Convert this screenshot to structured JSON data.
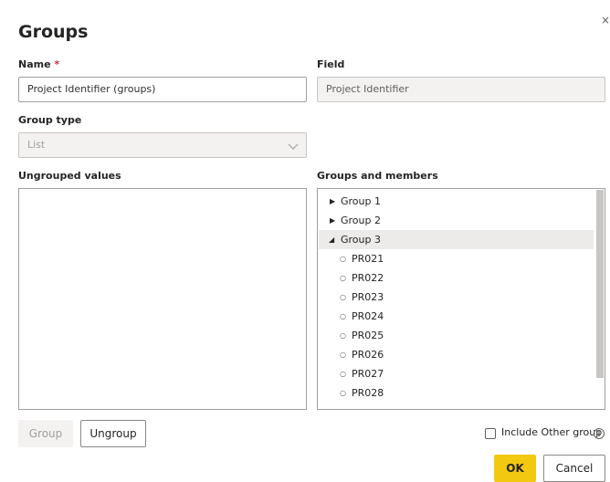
{
  "dialog": {
    "title": "Groups",
    "close_glyph": "×"
  },
  "name_field": {
    "label": "Name",
    "required_mark": "*",
    "value": "Project Identifier (groups)"
  },
  "field_field": {
    "label": "Field",
    "value": "Project Identifier"
  },
  "group_type": {
    "label": "Group type",
    "value": "List",
    "icon": "chevron-down-icon"
  },
  "ungrouped": {
    "label": "Ungrouped values",
    "items": []
  },
  "groups": {
    "label": "Groups and members",
    "items": [
      {
        "label": "Group 1",
        "expanded": false
      },
      {
        "label": "Group 2",
        "expanded": false
      },
      {
        "label": "Group 3",
        "expanded": true,
        "selected": true
      },
      {
        "label": "PR021",
        "member": true
      },
      {
        "label": "PR022",
        "member": true
      },
      {
        "label": "PR023",
        "member": true
      },
      {
        "label": "PR024",
        "member": true
      },
      {
        "label": "PR025",
        "member": true
      },
      {
        "label": "PR026",
        "member": true
      },
      {
        "label": "PR027",
        "member": true
      },
      {
        "label": "PR028",
        "member": true
      }
    ]
  },
  "buttons": {
    "group": "Group",
    "ungroup": "Ungroup",
    "ok": "OK",
    "cancel": "Cancel"
  },
  "include_other": {
    "label": "Include Other group",
    "checked": false,
    "info_glyph": "i"
  },
  "colors": {
    "accent": "#f2c811",
    "required": "#c4314b",
    "selected_row": "#edebe9"
  }
}
